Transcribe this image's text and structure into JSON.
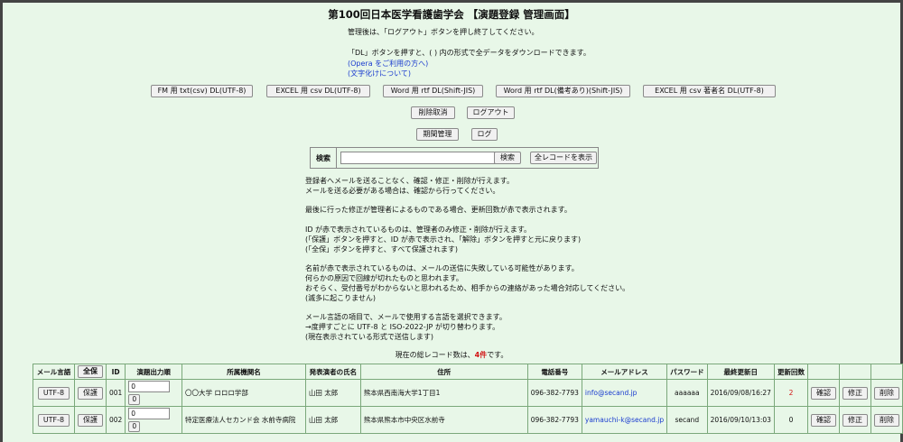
{
  "header": {
    "title": "第100回日本医学看護歯学会 【演題登録 管理画面】"
  },
  "intro": {
    "logout_note": "管理後は、「ログアウト」ボタンを押し終了してください。",
    "dl_note": "「DL」ボタンを押すと、( ) 内の形式で全データをダウンロードできます。",
    "opera_link": "(Opera をご利用の方へ)",
    "charset_link": "(文字化けについて)"
  },
  "downloads": {
    "fm_txt": "FM 用 txt(csv) DL(UTF-8)",
    "excel_csv": "EXCEL 用 csv DL(UTF-8)",
    "word_rtf": "Word 用 rtf DL(Shift-JIS)",
    "word_rtf_notes": "Word 用 rtf DL(備考あり)(Shift-JIS)",
    "excel_author": "EXCEL 用 csv 著者名 DL(UTF-8)"
  },
  "actions": {
    "undo_delete": "削除取消",
    "logout": "ログアウト",
    "period": "期間管理",
    "log": "ログ"
  },
  "search": {
    "label": "検索",
    "input_value": "",
    "button": "検索",
    "show_all": "全レコードを表示"
  },
  "notes": [
    "登録者へメールを送ることなく、確認・修正・削除が行えます。",
    "メールを送る必要がある場合は、確認から行ってください。",
    "",
    "最後に行った修正が管理者によるものである場合、更新回数が赤で表示されます。",
    "",
    "ID が赤で表示されているものは、管理者のみ修正・削除が行えます。",
    "(「保護」ボタンを押すと、ID が赤で表示され、「解除」ボタンを押すと元に戻ります)",
    "(「全保」ボタンを押すと、すべて保護されます)",
    "",
    "名前が赤で表示されているものは、メールの送信に失敗している可能性があります。",
    "何らかの原因で回線が切れたものと思われます。",
    "おそらく、受付番号がわからないと思われるため、相手からの連絡があった場合対応してください。",
    "(滅多に起こりません)",
    "",
    "メール言語の項目で、メールで使用する言語を選択できます。",
    "→度押すごとに UTF-8 と ISO-2022-JP が切り替わります。",
    "(現在表示されている形式で送信します)"
  ],
  "count": {
    "prefix": "現在の総レコード数は、",
    "value": "4件",
    "suffix": "です。"
  },
  "table": {
    "headers": {
      "mail_lang": "メール言語",
      "protect_all": "全保",
      "id": "ID",
      "order": "演題出力順",
      "affiliation": "所属機関名",
      "presenter": "発表演者の氏名",
      "address": "住所",
      "phone": "電話番号",
      "email": "メールアドレス",
      "password": "パスワード",
      "last_updated": "最終更新日",
      "update_count": "更新回数"
    },
    "rows": [
      {
        "lang": "UTF-8",
        "protect": "保護",
        "id": "001",
        "order": "0",
        "order_btn": "0",
        "affiliation": "〇〇大学 ロロロ学部",
        "presenter": "山田 太郎",
        "address": "熊本県西南海大学1丁目1",
        "phone": "096-382-7793",
        "email": "info@secand.jp",
        "password": "aaaaaa",
        "updated": "2016/09/08/16:27",
        "count": "2",
        "confirm": "確認",
        "edit": "修正",
        "delete": "削除"
      },
      {
        "lang": "UTF-8",
        "protect": "保護",
        "id": "002",
        "order": "0",
        "order_btn": "0",
        "affiliation": "特定医療法人セカンド会 水前寺病院",
        "presenter": "山田 太郎",
        "address": "熊本県熊本市中央区水前寺",
        "phone": "096-382-7793",
        "email": "yamauchi-k@secand.jp",
        "password": "secand",
        "updated": "2016/09/10/13:03",
        "count": "0",
        "confirm": "確認",
        "edit": "修正",
        "delete": "削除"
      }
    ]
  },
  "colors": {
    "background": "#e8f7e8",
    "link": "#1a3ccf",
    "alert": "#d21414"
  }
}
